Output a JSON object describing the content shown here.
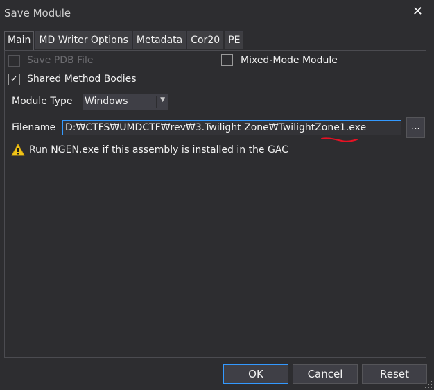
{
  "window": {
    "title": "Save Module",
    "close_icon": "✕"
  },
  "tabs": [
    "Main",
    "MD Writer Options",
    "Metadata",
    "Cor20",
    "PE"
  ],
  "active_tab": 0,
  "options": {
    "save_pdb": {
      "label": "Save PDB File",
      "checked": false,
      "enabled": false
    },
    "mixed_mode": {
      "label": "Mixed-Mode Module",
      "checked": false,
      "enabled": true
    },
    "shared_method_bodies": {
      "label": "Shared Method Bodies",
      "checked": true,
      "enabled": true,
      "check_glyph": "✓"
    }
  },
  "module_type": {
    "label": "Module Type",
    "value": "Windows",
    "arrow": "▼"
  },
  "filename": {
    "label": "Filename",
    "value": "D:₩CTFS₩UMDCTF₩rev₩3.Twilight Zone₩TwilightZone1.exe",
    "browse_label": "..."
  },
  "warning": {
    "text": "Run NGEN.exe if this assembly is installed in the GAC",
    "icon": "warning-icon"
  },
  "buttons": {
    "ok": "OK",
    "cancel": "Cancel",
    "reset": "Reset"
  },
  "colors": {
    "background": "#2d2d30",
    "accent": "#3399ff",
    "warning": "#f0c419",
    "annotation": "#e81123"
  }
}
